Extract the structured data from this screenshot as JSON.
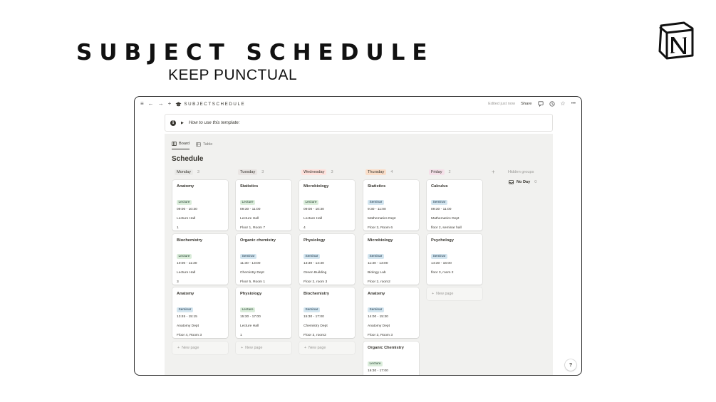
{
  "hero": {
    "title": "SUBJECT SCHEDULE",
    "subtitle": "KEEP PUNCTUAL"
  },
  "logo": {
    "icon": "notion-logo",
    "letter": "N"
  },
  "topbar": {
    "menu_icon": "≡",
    "back_icon": "←",
    "forward_icon": "→",
    "add_icon": "+",
    "page_icon": "graduation-cap-icon",
    "breadcrumb": "SUBJECTSCHEDULE",
    "edited": "Edited just now",
    "share": "Share",
    "comment_icon": "comment-icon",
    "clock_icon": "clock-icon",
    "star_icon": "star-icon",
    "more_icon": "•••"
  },
  "callout": {
    "text": "How to use this template:"
  },
  "views": [
    {
      "label": "Board",
      "active": true
    },
    {
      "label": "Table",
      "active": false
    }
  ],
  "board": {
    "title": "Schedule",
    "hidden_groups": "Hidden groups",
    "no_day": {
      "label": "No Day",
      "count": "0"
    },
    "new_page": "New page",
    "columns": [
      {
        "name": "Monday",
        "count": "3",
        "color": "#e9e9e7",
        "cards": [
          {
            "title": "Anatomy",
            "tag": "Lecture",
            "time": "09:00 - 10:30",
            "place": "Lecture Hall",
            "room": "1"
          },
          {
            "title": "Biochemistry",
            "tag": "Lecture",
            "time": "10:00 - 11:30",
            "place": "Lecture Hall",
            "room": "3"
          },
          {
            "title": "Anatomy",
            "tag": "Seminar",
            "time": "13:45 - 15:15",
            "place": "Anatomy Dept",
            "room": "Floor 4, Room 3"
          }
        ]
      },
      {
        "name": "Tuesday",
        "count": "3",
        "color": "#e9e5e3",
        "cards": [
          {
            "title": "Statistics",
            "tag": "Lecture",
            "time": "09:30 - 11:00",
            "place": "Lecture Hall",
            "room": "Floor 1, Room 7"
          },
          {
            "title": "Organic chemistry",
            "tag": "Seminar",
            "time": "11:30 - 13:00",
            "place": "Chemistry Dept",
            "room": "Floor 5,  Room 1"
          },
          {
            "title": "Physiology",
            "tag": "Lecture",
            "time": "15:30 - 17:00",
            "place": "Lecture Hall",
            "room": "1"
          }
        ]
      },
      {
        "name": "Wednesday",
        "count": "3",
        "color": "#ffe2dd",
        "cards": [
          {
            "title": "Microbiology",
            "tag": "Lecture",
            "time": "09:00 - 10:30",
            "place": "Lecture Hall",
            "room": "4"
          },
          {
            "title": "Physiology",
            "tag": "Seminar",
            "time": "13:30 - 14:30",
            "place": "Green Building",
            "room": "Floor 2, room 3"
          },
          {
            "title": "Biochemistry",
            "tag": "Seminar",
            "time": "15:30 - 17:00",
            "place": "Chemistry Dept",
            "room": "Floor 3, room2"
          }
        ]
      },
      {
        "name": "Thursday",
        "count": "4",
        "color": "#fadec9",
        "cards": [
          {
            "title": "Statistics",
            "tag": "Seminar",
            "time": "9:30 - 11:00",
            "place": "Mathematics Dept",
            "room": "Floor 3, Room 6"
          },
          {
            "title": "Microbiology",
            "tag": "Seminar",
            "time": "11:30 - 13:00",
            "place": "Biology Lab",
            "room": "Floor 2, room2"
          },
          {
            "title": "Anatomy",
            "tag": "Seminar",
            "time": "14:00 - 15:30",
            "place": "Anatomy Dept",
            "room": "Floor 3, Room 3"
          },
          {
            "title": "Organic Chemistry",
            "tag": "Lecture",
            "time": "16:30 - 17:00",
            "place": "",
            "room": ""
          }
        ]
      },
      {
        "name": "Friday",
        "count": "2",
        "color": "#f5e0e9",
        "cards": [
          {
            "title": "Calculus",
            "tag": "Seminar",
            "time": "09:30 - 11:00",
            "place": "Mathematics Dept",
            "room": "floor 2, seminar hall"
          },
          {
            "title": "Psychology",
            "tag": "Seminar",
            "time": "14:30 - 16:00",
            "place": "floor 3, room 2",
            "room": ""
          }
        ]
      }
    ]
  },
  "colors": {
    "lecture_tag": "#dbeddb",
    "seminar_tag": "#d3e5ef",
    "board_bg": "#f1f1ef"
  }
}
